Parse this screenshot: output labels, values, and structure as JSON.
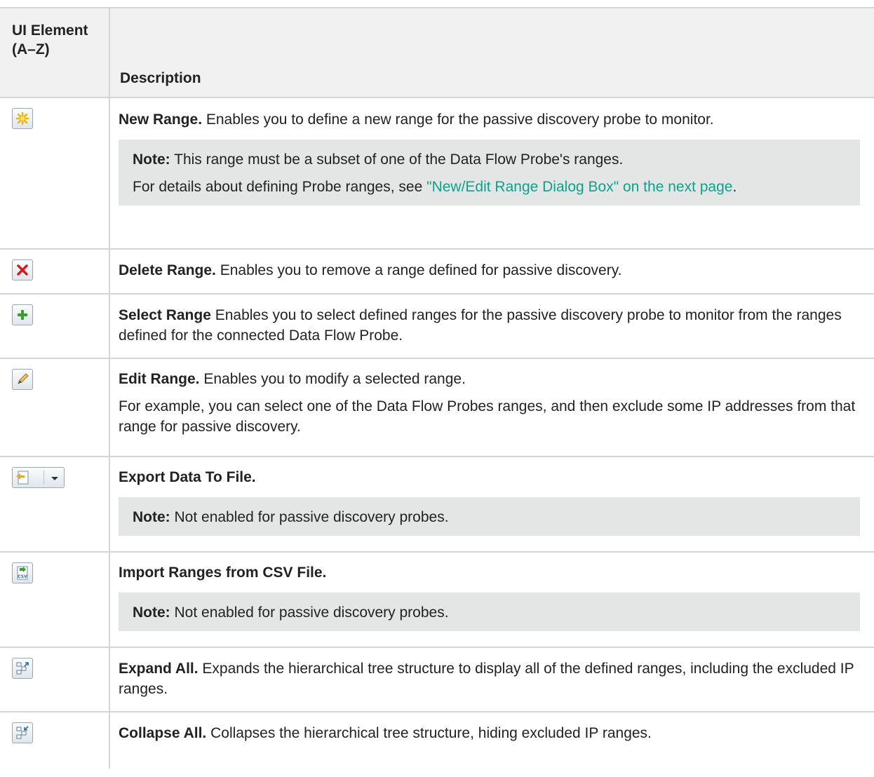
{
  "header": {
    "col1": "UI Element (A–Z)",
    "col2": "Description"
  },
  "rows": [
    {
      "icon": "new-range-icon",
      "title": "New Range.",
      "text": " Enables you to define a new range for the passive discovery probe to monitor.",
      "note_label": "Note:",
      "note_text": " This range must be a subset of one of the Data Flow Probe's ranges.",
      "note_text2_pre": "For details about defining Probe ranges, see ",
      "note_link": "\"New/Edit Range Dialog Box\" on the next page",
      "note_text2_post": "."
    },
    {
      "icon": "delete-range-icon",
      "title": "Delete Range.",
      "text": " Enables you to remove a range defined for passive discovery."
    },
    {
      "icon": "select-range-icon",
      "title": "Select Range",
      "text": " Enables you to select defined ranges for the passive discovery probe to monitor from the ranges defined for the connected Data Flow Probe."
    },
    {
      "icon": "edit-range-icon",
      "title": "Edit Range.",
      "text": " Enables you to modify a selected range.",
      "text2": "For example, you can select one of the Data Flow Probes ranges, and then exclude some IP addresses from that range for passive discovery."
    },
    {
      "icon": "export-data-icon",
      "title": "Export Data To File.",
      "note_label": "Note:",
      "note_text": " Not enabled for passive discovery probes."
    },
    {
      "icon": "import-csv-icon",
      "title": "Import Ranges from CSV File.",
      "note_label": "Note:",
      "note_text": " Not enabled for passive discovery probes."
    },
    {
      "icon": "expand-all-icon",
      "title": "Expand All.",
      "text": " Expands the hierarchical tree structure to display all of the defined ranges, including the excluded IP ranges."
    },
    {
      "icon": "collapse-all-icon",
      "title": "Collapse All.",
      "text": " Collapses the hierarchical tree structure, hiding excluded IP ranges."
    }
  ]
}
